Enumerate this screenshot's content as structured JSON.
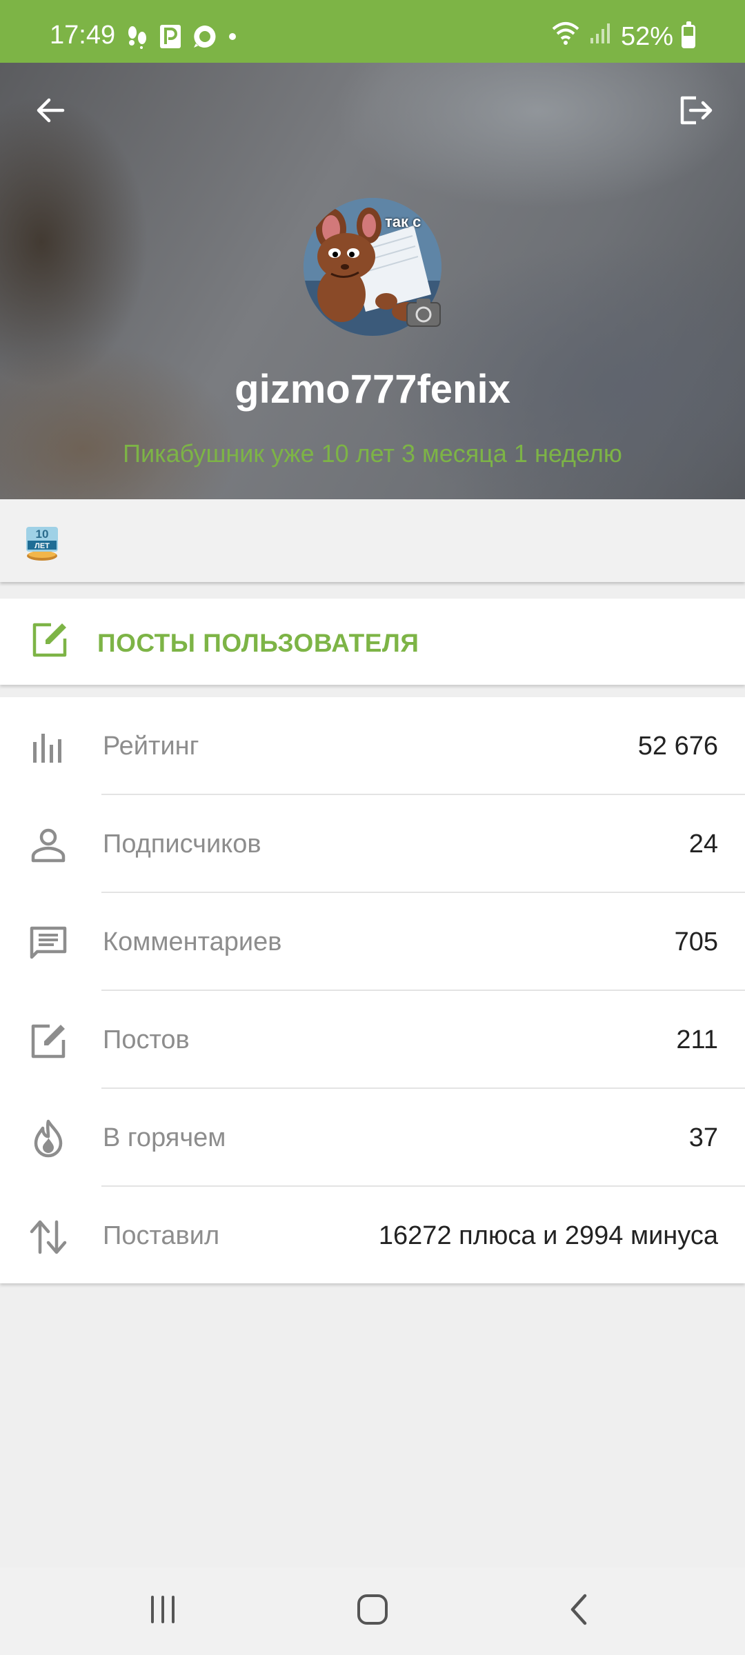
{
  "status_bar": {
    "time": "17:49",
    "battery": "52%",
    "battery_level": 0.52,
    "icons_left": [
      "steps-icon",
      "parking-icon",
      "chat-bubble-icon",
      "dot-icon"
    ],
    "icons_right": [
      "wifi-icon",
      "signal-icon",
      "battery-icon"
    ]
  },
  "header": {
    "back_icon": "arrow-left-icon",
    "logout_icon": "logout-icon",
    "avatar_caption": "так с",
    "camera_icon": "camera-icon",
    "username": "gizmo777fenix",
    "tenure": "Пикабушник уже 10 лет 3 месяца 1 неделю"
  },
  "awards": {
    "badge_text_top": "10",
    "badge_text_bottom": "ЛЕТ"
  },
  "posts_button": {
    "label": "ПОСТЫ ПОЛЬЗОВАТЕЛЯ",
    "icon": "edit-icon"
  },
  "stats": [
    {
      "icon": "bar-chart-icon",
      "label": "Рейтинг",
      "value": "52 676"
    },
    {
      "icon": "person-icon",
      "label": "Подписчиков",
      "value": "24"
    },
    {
      "icon": "comment-icon",
      "label": "Комментариев",
      "value": "705"
    },
    {
      "icon": "edit-icon",
      "label": "Постов",
      "value": "211"
    },
    {
      "icon": "flame-icon",
      "label": "В горячем",
      "value": "37"
    },
    {
      "icon": "arrows-up-down-icon",
      "label": "Поставил",
      "value": "16272 плюса и 2994 минуса"
    }
  ],
  "colors": {
    "accent": "#7db446",
    "status_bar": "#7db446",
    "label_gray": "#8d8d8d",
    "value_dark": "#222222",
    "background": "#efefef"
  }
}
